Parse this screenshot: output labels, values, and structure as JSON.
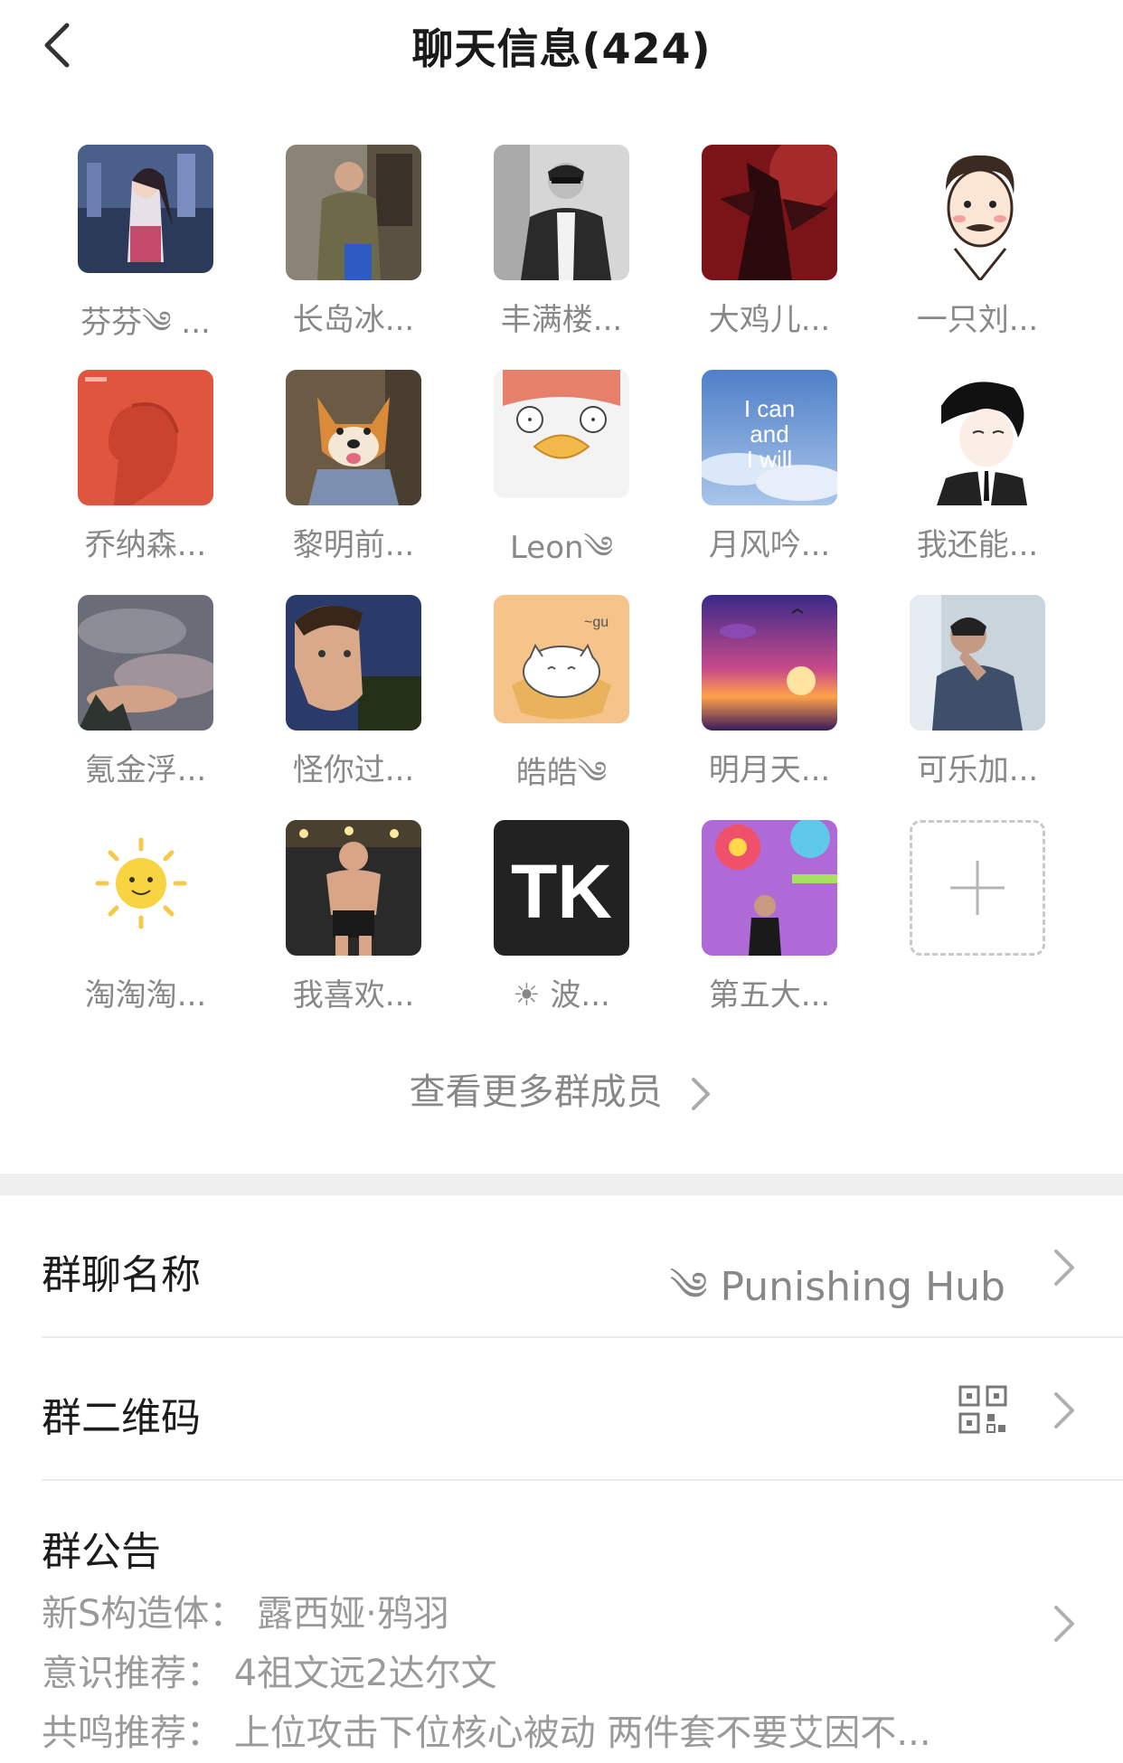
{
  "header": {
    "title": "聊天信息(424)"
  },
  "members": [
    {
      "name": "芬芬༄ ..."
    },
    {
      "name": "长岛冰..."
    },
    {
      "name": "丰满楼..."
    },
    {
      "name": "大鸡儿..."
    },
    {
      "name": "一只刘..."
    },
    {
      "name": "乔纳森..."
    },
    {
      "name": "黎明前..."
    },
    {
      "name": "Leon༄"
    },
    {
      "name": "月风吟..."
    },
    {
      "name": "我还能..."
    },
    {
      "name": "氪金浮..."
    },
    {
      "name": "怪你过..."
    },
    {
      "name": "皓皓༄"
    },
    {
      "name": "明月天..."
    },
    {
      "name": "可乐加..."
    },
    {
      "name": "淘淘淘..."
    },
    {
      "name": "我喜欢..."
    },
    {
      "name": "☀ 波..."
    },
    {
      "name": "第五大..."
    }
  ],
  "avatar_text": {
    "yuefeng": "I can and I will",
    "tk": "TK"
  },
  "more_members": "查看更多群成员",
  "settings": {
    "group_name_label": "群聊名称",
    "group_name_value": "༄ Punishing Hub",
    "qr_label": "群二维码",
    "notice_label": "群公告",
    "notice_lines": [
      "新S构造体：  露西娅·鸦羽",
      "意识推荐：  4祖文远2达尔文",
      "共鸣推荐：  上位攻击下位核心被动  两件套不要艾因不..."
    ]
  },
  "colors": {
    "muted": "#888888",
    "separator": "#efefef",
    "text": "#1c1c1c"
  }
}
